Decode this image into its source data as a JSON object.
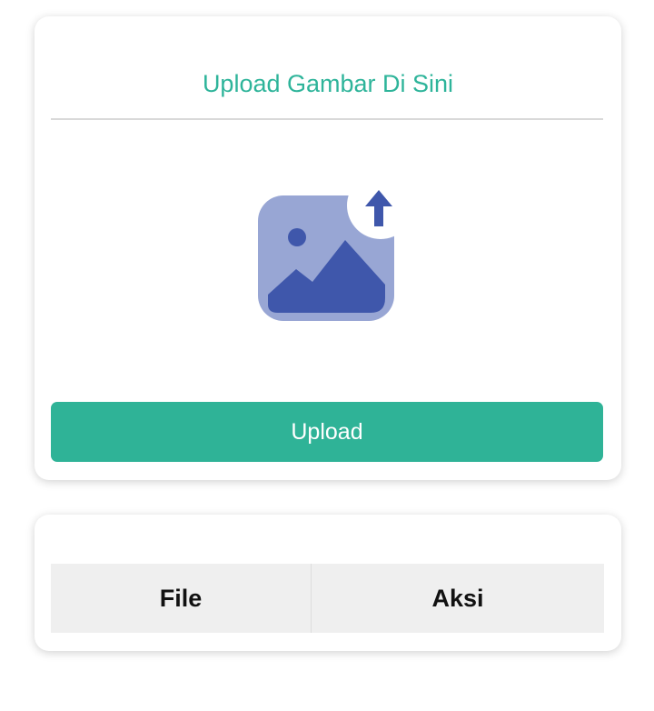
{
  "upload_card": {
    "title": "Upload Gambar Di Sini",
    "icon": "image-upload-icon",
    "button_label": "Upload"
  },
  "files_table": {
    "columns": [
      "File",
      "Aksi"
    ]
  },
  "colors": {
    "accent": "#2fb397",
    "title_text": "#2eb49a",
    "icon_light": "#98a6d4",
    "icon_dark": "#3f57ab",
    "table_header_bg": "#efefef"
  }
}
